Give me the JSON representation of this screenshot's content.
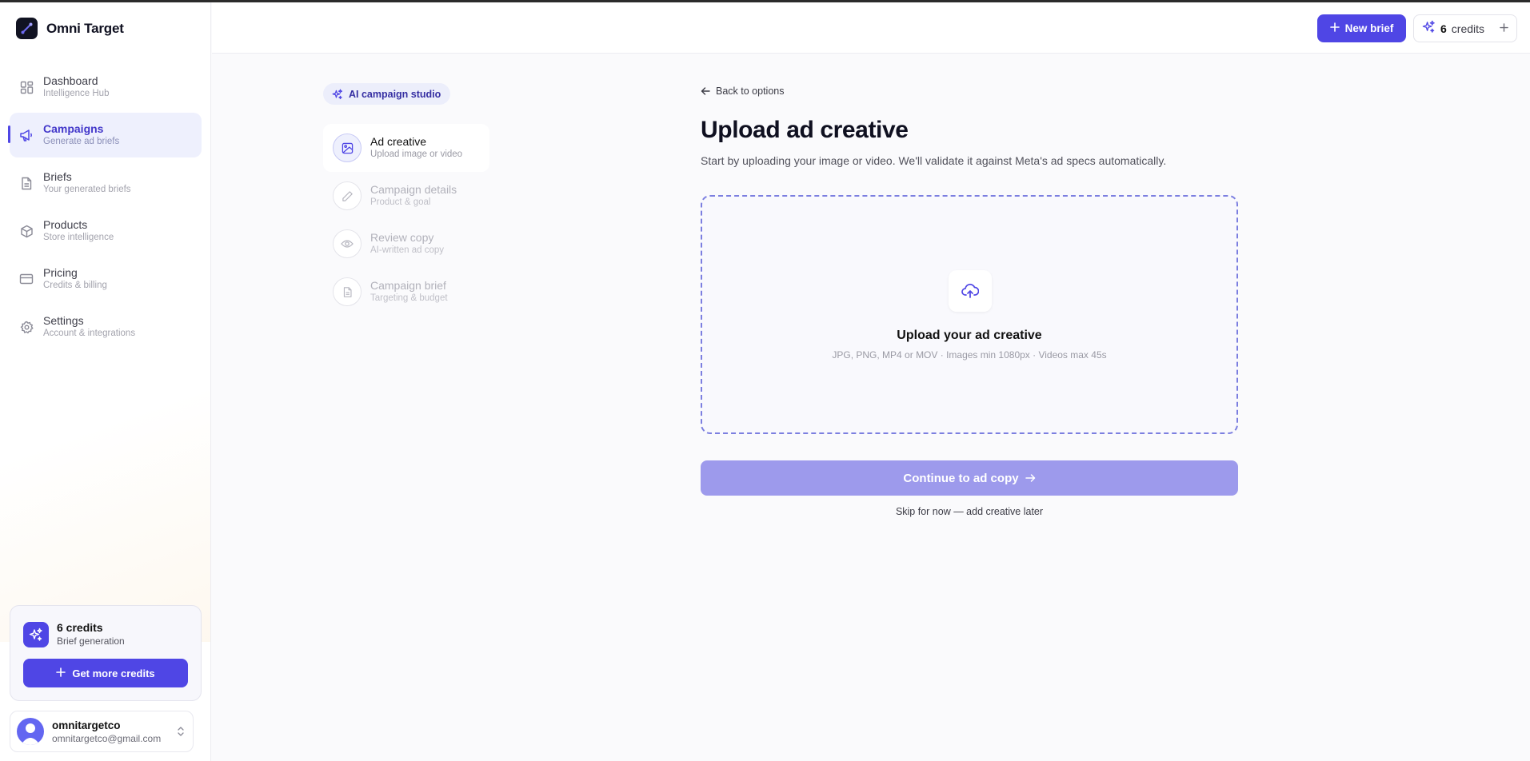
{
  "brand": {
    "name": "Omni Target"
  },
  "sidebar": {
    "items": [
      {
        "label": "Dashboard",
        "sub": "Intelligence Hub",
        "icon": "dashboard-icon"
      },
      {
        "label": "Campaigns",
        "sub": "Generate ad briefs",
        "icon": "megaphone-icon"
      },
      {
        "label": "Briefs",
        "sub": "Your generated briefs",
        "icon": "document-icon"
      },
      {
        "label": "Products",
        "sub": "Store intelligence",
        "icon": "box-icon"
      },
      {
        "label": "Pricing",
        "sub": "Credits & billing",
        "icon": "credit-card-icon"
      },
      {
        "label": "Settings",
        "sub": "Account & integrations",
        "icon": "gear-icon"
      }
    ],
    "active": "Campaigns",
    "credits": {
      "title": "6 credits",
      "sub": "Brief generation",
      "button": "Get more credits"
    },
    "user": {
      "name": "omnitargetco",
      "email": "omnitargetco@gmail.com"
    }
  },
  "header": {
    "new_brief": "New brief",
    "credits_num": "6",
    "credits_word": "credits"
  },
  "steps": {
    "chip": "AI campaign studio",
    "items": [
      {
        "label": "Ad creative",
        "sub": "Upload image or video",
        "icon": "image-icon"
      },
      {
        "label": "Campaign details",
        "sub": "Product & goal",
        "icon": "pencil-icon"
      },
      {
        "label": "Review copy",
        "sub": "AI-written ad copy",
        "icon": "eye-icon"
      },
      {
        "label": "Campaign brief",
        "sub": "Targeting & budget",
        "icon": "document-icon"
      }
    ],
    "current": 0
  },
  "main": {
    "back": "Back to options",
    "title": "Upload ad creative",
    "description": "Start by uploading your image or video. We'll validate it against Meta's ad specs automatically.",
    "dropzone": {
      "title": "Upload your ad creative",
      "sub": "JPG, PNG, MP4 or MOV · Images min 1080px · Videos max 45s"
    },
    "continue": "Continue to ad copy",
    "skip": "Skip for now — add creative later"
  },
  "colors": {
    "accent": "#4f46e5",
    "accent_light": "#eef0fd",
    "disabled_button": "#9d9aec"
  }
}
